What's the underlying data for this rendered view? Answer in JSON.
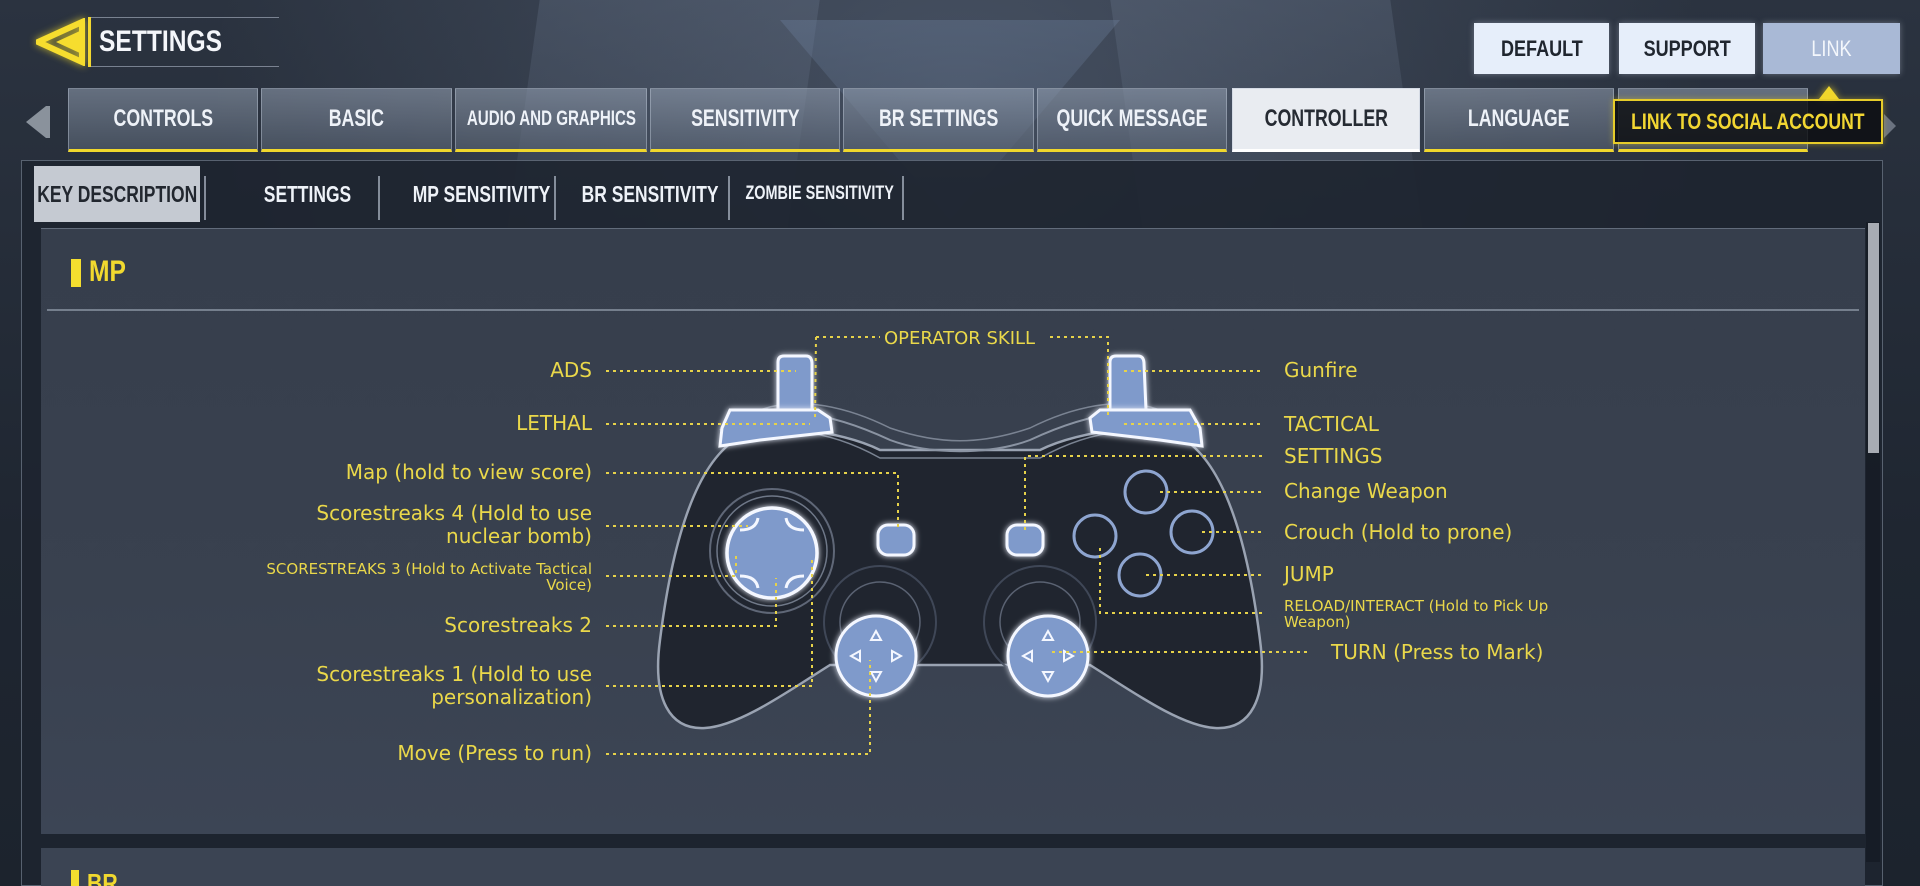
{
  "header": {
    "title": "SETTINGS",
    "back_icon": "back-arrow-icon",
    "buttons": {
      "default": "DEFAULT",
      "support": "SUPPORT",
      "link": "LINK"
    }
  },
  "tabs": [
    {
      "label": "CONTROLS",
      "active": false
    },
    {
      "label": "BASIC",
      "active": false
    },
    {
      "label": "AUDIO AND GRAPHICS",
      "active": false
    },
    {
      "label": "SENSITIVITY",
      "active": false
    },
    {
      "label": "BR SETTINGS",
      "active": false
    },
    {
      "label": "QUICK MESSAGE",
      "active": false
    },
    {
      "label": "CONTROLLER",
      "active": true
    },
    {
      "label": "LANGUAGE",
      "active": false
    },
    {
      "label": "",
      "active": false
    }
  ],
  "tooltip": {
    "text": "LINK TO SOCIAL ACCOUNT"
  },
  "subtabs": [
    {
      "label": "KEY DESCRIPTION",
      "active": true
    },
    {
      "label": "SETTINGS",
      "active": false
    },
    {
      "label": "MP SENSITIVITY",
      "active": false
    },
    {
      "label": "BR SENSITIVITY",
      "active": false
    },
    {
      "label": "ZOMBIE SENSITIVITY",
      "active": false
    }
  ],
  "section": {
    "title": "MP",
    "next_title": "BR"
  },
  "controller": {
    "top_label": "OPERATOR SKILL",
    "left_labels": {
      "ads": "ADS",
      "lethal": "LETHAL",
      "map": "Map (hold to view score)",
      "scorestreaks4_line1": "Scorestreaks 4 (Hold to use",
      "scorestreaks4_line2": "nuclear bomb)",
      "scorestreaks3_line1": "SCORESTREAKS 3 (Hold to Activate Tactical",
      "scorestreaks3_line2": "Voice)",
      "scorestreaks2": "Scorestreaks 2",
      "scorestreaks1_line1": "Scorestreaks 1 (Hold to use",
      "scorestreaks1_line2": "personalization)",
      "move": "Move (Press to run)"
    },
    "right_labels": {
      "gunfire": "Gunfire",
      "tactical": "TACTICAL",
      "settings": "SETTINGS",
      "change_weapon": "Change Weapon",
      "crouch": "Crouch (Hold to prone)",
      "jump": "JUMP",
      "reload_line1": "RELOAD/INTERACT (Hold to Pick Up",
      "reload_line2": "Weapon)",
      "turn": "TURN (Press to Mark)"
    }
  },
  "colors": {
    "accent_yellow": "#f0d72c",
    "label_yellow": "#ead84a",
    "button_fill": "#7f9acb"
  }
}
